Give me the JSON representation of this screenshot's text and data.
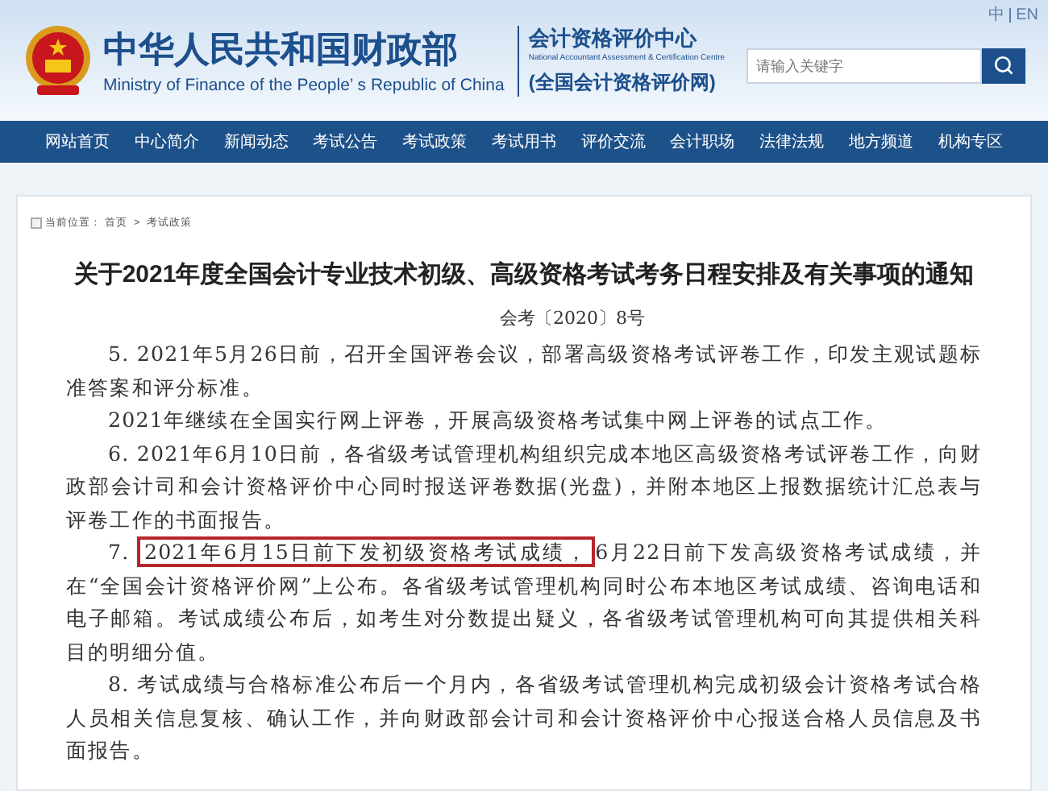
{
  "header": {
    "site_name": "中华人民共和国财政部",
    "site_name_en": "Ministry of Finance of the People’ s Republic of China",
    "center_name": "会计资格评价中心",
    "center_name_en": "National Accountant Assessment & Certification Centre",
    "network_name": "(全国会计资格评价网)",
    "languages": [
      "中",
      "EN"
    ],
    "search": {
      "placeholder": "请输入关键字"
    }
  },
  "nav": [
    "网站首页",
    "中心简介",
    "新闻动态",
    "考试公告",
    "考试政策",
    "考试用书",
    "评价交流",
    "会计职场",
    "法律法规",
    "地方频道",
    "机构专区"
  ],
  "breadcrumb": {
    "label": "当前位置：",
    "items": [
      "首页",
      "考试政策"
    ],
    "separator": ">"
  },
  "article": {
    "title": "关于2021年度全国会计专业技术初级、高级资格考试考务日程安排及有关事项的通知",
    "doc_number": "会考〔2020〕8号",
    "paragraphs": [
      {
        "kind": "plain",
        "text": "5. 2021年5月26日前，召开全国评卷会议，部署高级资格考试评卷工作，印发主观试题标准答案和评分标准。"
      },
      {
        "kind": "plain",
        "text": "2021年继续在全国实行网上评卷，开展高级资格考试集中网上评卷的试点工作。"
      },
      {
        "kind": "plain",
        "text": "6. 2021年6月10日前，各省级考试管理机构组织完成本地区高级资格考试评卷工作，向财政部会计司和会计资格评价中心同时报送评卷数据(光盘)，并附本地区上报数据统计汇总表与评卷工作的书面报告。"
      },
      {
        "kind": "highlighted",
        "before": "7. ",
        "highlight": "2021年6月15日前下发初级资格考试成绩，",
        "after": "6月22日前下发高级资格考试成绩，并在“全国会计资格评价网”上公布。各省级考试管理机构同时公布本地区考试成绩、咨询电话和电子邮箱。考试成绩公布后，如考生对分数提出疑义，各省级考试管理机构可向其提供相关科目的明细分值。"
      },
      {
        "kind": "plain",
        "text": "8. 考试成绩与合格标准公布后一个月内，各省级考试管理机构完成初级会计资格考试合格人员相关信息复核、确认工作，并向财政部会计司和会计资格评价中心报送合格人员信息及书面报告。"
      }
    ]
  }
}
